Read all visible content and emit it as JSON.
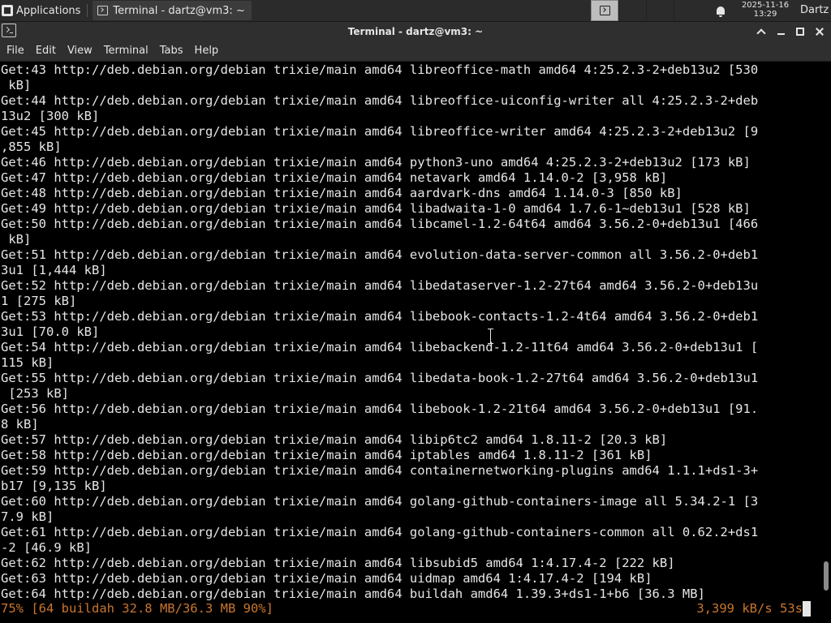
{
  "taskbar": {
    "applications_label": "Applications",
    "task_title": "Terminal - dartz@vm3: ~",
    "clock_date": "2025-11-16",
    "clock_time": "13:29",
    "user": "Dartz"
  },
  "window": {
    "title": "Terminal - dartz@vm3: ~"
  },
  "menu": {
    "items": [
      "File",
      "Edit",
      "View",
      "Terminal",
      "Tabs",
      "Help"
    ]
  },
  "terminal": {
    "lines": [
      "Get:43 http://deb.debian.org/debian trixie/main amd64 libreoffice-math amd64 4:25.2.3-2+deb13u2 [530",
      " kB]",
      "Get:44 http://deb.debian.org/debian trixie/main amd64 libreoffice-uiconfig-writer all 4:25.2.3-2+deb",
      "13u2 [300 kB]",
      "Get:45 http://deb.debian.org/debian trixie/main amd64 libreoffice-writer amd64 4:25.2.3-2+deb13u2 [9",
      ",855 kB]",
      "Get:46 http://deb.debian.org/debian trixie/main amd64 python3-uno amd64 4:25.2.3-2+deb13u2 [173 kB]",
      "Get:47 http://deb.debian.org/debian trixie/main amd64 netavark amd64 1.14.0-2 [3,958 kB]",
      "Get:48 http://deb.debian.org/debian trixie/main amd64 aardvark-dns amd64 1.14.0-3 [850 kB]",
      "Get:49 http://deb.debian.org/debian trixie/main amd64 libadwaita-1-0 amd64 1.7.6-1~deb13u1 [528 kB]",
      "Get:50 http://deb.debian.org/debian trixie/main amd64 libcamel-1.2-64t64 amd64 3.56.2-0+deb13u1 [466",
      " kB]",
      "Get:51 http://deb.debian.org/debian trixie/main amd64 evolution-data-server-common all 3.56.2-0+deb1",
      "3u1 [1,444 kB]",
      "Get:52 http://deb.debian.org/debian trixie/main amd64 libedataserver-1.2-27t64 amd64 3.56.2-0+deb13u",
      "1 [275 kB]",
      "Get:53 http://deb.debian.org/debian trixie/main amd64 libebook-contacts-1.2-4t64 amd64 3.56.2-0+deb1",
      "3u1 [70.0 kB]",
      "Get:54 http://deb.debian.org/debian trixie/main amd64 libebackend-1.2-11t64 amd64 3.56.2-0+deb13u1 [",
      "115 kB]",
      "Get:55 http://deb.debian.org/debian trixie/main amd64 libedata-book-1.2-27t64 amd64 3.56.2-0+deb13u1",
      " [253 kB]",
      "Get:56 http://deb.debian.org/debian trixie/main amd64 libebook-1.2-21t64 amd64 3.56.2-0+deb13u1 [91.",
      "8 kB]",
      "Get:57 http://deb.debian.org/debian trixie/main amd64 libip6tc2 amd64 1.8.11-2 [20.3 kB]",
      "Get:58 http://deb.debian.org/debian trixie/main amd64 iptables amd64 1.8.11-2 [361 kB]",
      "Get:59 http://deb.debian.org/debian trixie/main amd64 containernetworking-plugins amd64 1.1.1+ds1-3+",
      "b17 [9,135 kB]",
      "Get:60 http://deb.debian.org/debian trixie/main amd64 golang-github-containers-image all 5.34.2-1 [3",
      "7.9 kB]",
      "Get:61 http://deb.debian.org/debian trixie/main amd64 golang-github-containers-common all 0.62.2+ds1",
      "-2 [46.9 kB]",
      "Get:62 http://deb.debian.org/debian trixie/main amd64 libsubid5 amd64 1:4.17.4-2 [222 kB]",
      "Get:63 http://deb.debian.org/debian trixie/main amd64 uidmap amd64 1:4.17.4-2 [194 kB]",
      "Get:64 http://deb.debian.org/debian trixie/main amd64 buildah amd64 1.39.3+ds1-1+b6 [36.3 MB]"
    ],
    "status_left": "75% [64 buildah 32.8 MB/36.3 MB 90%]",
    "status_right": "3,399 kB/s 53s",
    "status_color": "#c9762f",
    "scroll_position": 0.95
  }
}
